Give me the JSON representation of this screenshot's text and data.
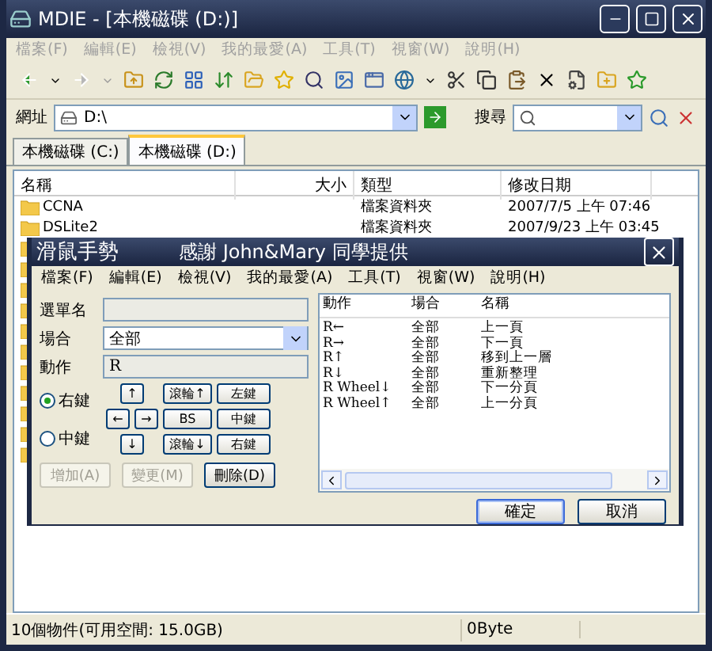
{
  "window": {
    "title": "MDIE - [本機磁碟 (D:)]"
  },
  "menu": [
    {
      "label": "檔案(F)",
      "disabled": true
    },
    {
      "label": "編輯(E)",
      "disabled": true
    },
    {
      "label": "檢視(V)",
      "disabled": true
    },
    {
      "label": "我的最愛(A)",
      "disabled": true
    },
    {
      "label": "工具(T)",
      "disabled": true
    },
    {
      "label": "視窗(W)",
      "disabled": true
    },
    {
      "label": "說明(H)",
      "disabled": true
    }
  ],
  "address": {
    "label": "網址",
    "value": "D:\\"
  },
  "search": {
    "label": "搜尋"
  },
  "tabs": [
    {
      "label": "本機磁碟 (C:)",
      "selected": false
    },
    {
      "label": "本機磁碟 (D:)",
      "selected": true
    }
  ],
  "table": {
    "columns": [
      "名稱",
      "大小",
      "類型",
      "修改日期"
    ],
    "rows": [
      {
        "kind": "folder",
        "name": "CCNA",
        "type": "檔案資料夾",
        "modified": "2007/7/5 上午 07:46"
      },
      {
        "kind": "folder",
        "name": "DSLite2",
        "type": "檔案資料夾",
        "modified": "2007/9/23 上午 03:45"
      },
      {
        "kind": "folder"
      },
      {
        "kind": "folder"
      },
      {
        "kind": "folder"
      },
      {
        "kind": "folder"
      },
      {
        "kind": "folder"
      },
      {
        "kind": "folder"
      },
      {
        "kind": "folder"
      },
      {
        "kind": "folder"
      },
      {
        "kind": "folder"
      },
      {
        "kind": "folder"
      },
      {
        "kind": "folder"
      }
    ]
  },
  "status_bar": [
    "10個物件(可用空間: 15.0GB)",
    "0Byte"
  ],
  "dialog": {
    "title": "滑鼠手勢",
    "credit": "感謝 John&Mary 同學提供",
    "menu": [
      {
        "label": "檔案(F)",
        "disabled": false
      },
      {
        "label": "編輯(E)",
        "disabled": false
      },
      {
        "label": "檢視(V)",
        "disabled": false
      },
      {
        "label": "我的最愛(A)",
        "disabled": false
      },
      {
        "label": "工具(T)",
        "disabled": false
      },
      {
        "label": "視窗(W)",
        "disabled": false
      },
      {
        "label": "說明(H)",
        "disabled": false
      }
    ],
    "fields": [
      {
        "kind": "text",
        "label": "選單名",
        "disabled": true
      },
      {
        "kind": "select",
        "label": "場合",
        "value": "全部",
        "disabled": false
      },
      {
        "kind": "text",
        "label": "動作",
        "value": "R",
        "disabled": true
      }
    ],
    "buttons_mode": [
      {
        "label": "右鍵",
        "selected": true
      },
      {
        "label": "中鍵",
        "selected": false
      }
    ],
    "keys": {
      "up": "↑",
      "left": "←",
      "right": "→",
      "down": "↓",
      "wheel_up": "滾輪↑",
      "bs": "BS",
      "wheel_down": "滾輪↓",
      "left_button": "左鍵",
      "middle_button": "中鍵",
      "right_button": "右鍵"
    },
    "actions": [
      {
        "label": "增加(A)",
        "disabled": true
      },
      {
        "label": "變更(M)",
        "disabled": true
      },
      {
        "label": "刪除(D)",
        "disabled": false
      }
    ],
    "list": {
      "columns": [
        "動作",
        "場合",
        "名稱"
      ],
      "rows": [
        [
          "R←",
          "全部",
          "上一頁"
        ],
        [
          "R→",
          "全部",
          "下一頁"
        ],
        [
          "R↑",
          "全部",
          "移到上一層"
        ],
        [
          "R↓",
          "全部",
          "重新整理"
        ],
        [
          "R Wheel↓",
          "全部",
          "下一分頁"
        ],
        [
          "R Wheel↑",
          "全部",
          "上一分頁"
        ]
      ]
    },
    "footer": [
      {
        "label": "確定",
        "default": true
      },
      {
        "label": "取消",
        "default": false
      }
    ]
  }
}
